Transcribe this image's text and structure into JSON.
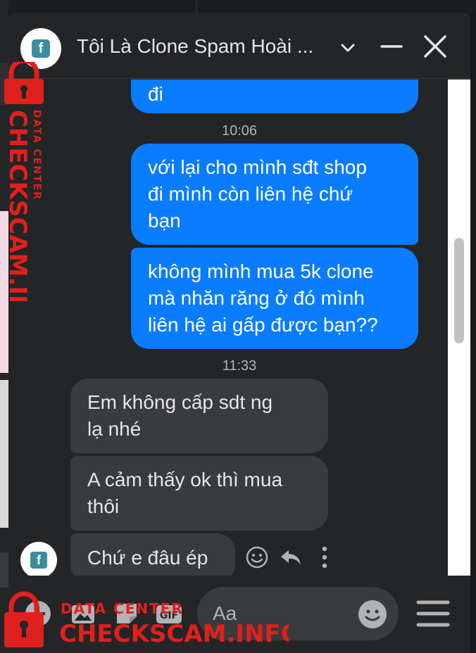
{
  "chat": {
    "title": "Tôi Là Clone Spam Hoài ...",
    "avatar_icon": "facebook-icon",
    "accent_color": "#0a7cff"
  },
  "messages": [
    {
      "type": "outgoing",
      "lines": [
        "đi"
      ]
    },
    {
      "type": "timestamp",
      "text": "10:06"
    },
    {
      "type": "outgoing",
      "lines": [
        "với lại cho mình sđt shop",
        "đi mình còn liên hệ chứ",
        "bạn"
      ]
    },
    {
      "type": "outgoing",
      "lines": [
        "không mình mua 5k clone",
        "mà nhăn răng ở đó mình",
        "liên hệ ai gấp được bạn??"
      ]
    },
    {
      "type": "timestamp",
      "text": "11:33"
    },
    {
      "type": "incoming",
      "lines": [
        "Em không cấp sdt ng",
        "lạ nhé"
      ]
    },
    {
      "type": "incoming",
      "lines": [
        "A cảm thấy ok thì mua",
        "thôi"
      ]
    },
    {
      "type": "incoming",
      "lines": [
        "Chứ e đâu ép"
      ]
    }
  ],
  "composer": {
    "placeholder": "Aa"
  },
  "watermark": {
    "data_center": "DATA CENTER",
    "site": "CHECKSCAM.INFO"
  }
}
